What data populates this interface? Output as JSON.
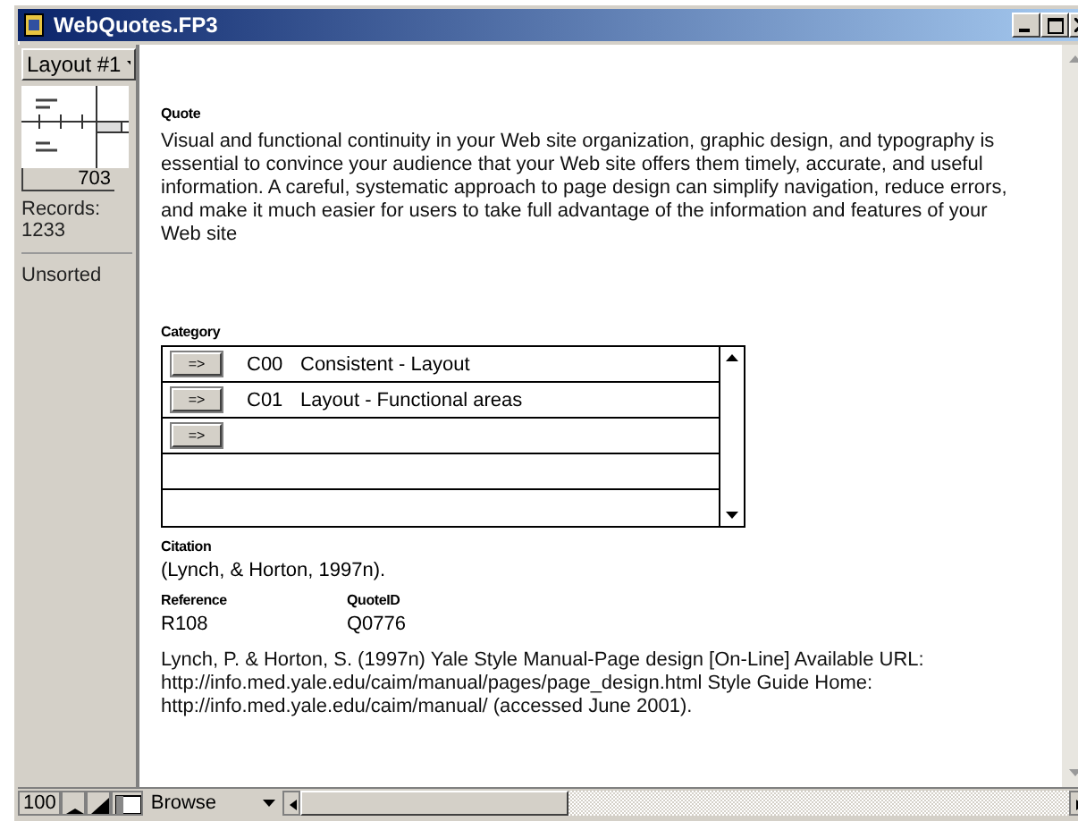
{
  "window": {
    "title": "WebQuotes.FP3"
  },
  "sidebar": {
    "layout_menu": "Layout #1",
    "record_number": "703",
    "records_label": "Records:",
    "records_count": "1233",
    "sort_status": "Unsorted"
  },
  "quote": {
    "label": "Quote",
    "text": "Visual and functional continuity in your Web site organization, graphic design, and typography is essential to convince your audience that your Web site offers them timely, accurate, and useful information. A careful, systematic approach to page design can simplify navigation, reduce errors, and make it much easier for users to take full advantage of the information and features of your Web site"
  },
  "category": {
    "label": "Category",
    "rows": [
      {
        "kind": "entry",
        "button": "=>",
        "code": "C00",
        "name": "Consistent - Layout"
      },
      {
        "kind": "entry",
        "button": "=>",
        "code": "C01",
        "name": "Layout - Functional areas"
      },
      {
        "kind": "button_only",
        "button": "=>"
      },
      {
        "kind": "blank"
      },
      {
        "kind": "blank"
      }
    ]
  },
  "citation": {
    "label": "Citation",
    "value": "(Lynch, & Horton, 1997n)."
  },
  "reference": {
    "label": "Reference",
    "value": "R108"
  },
  "quote_id": {
    "label": "QuoteID",
    "value": "Q0776"
  },
  "source": "Lynch, P. & Horton, S. (1997n) Yale Style Manual-Page design [On-Line] Available URL: http://info.med.yale.edu/caim/manual/pages/page_design.html Style Guide Home: http://info.med.yale.edu/caim/manual/ (accessed June 2001).",
  "status_bar": {
    "zoom": "100",
    "mode": "Browse"
  }
}
